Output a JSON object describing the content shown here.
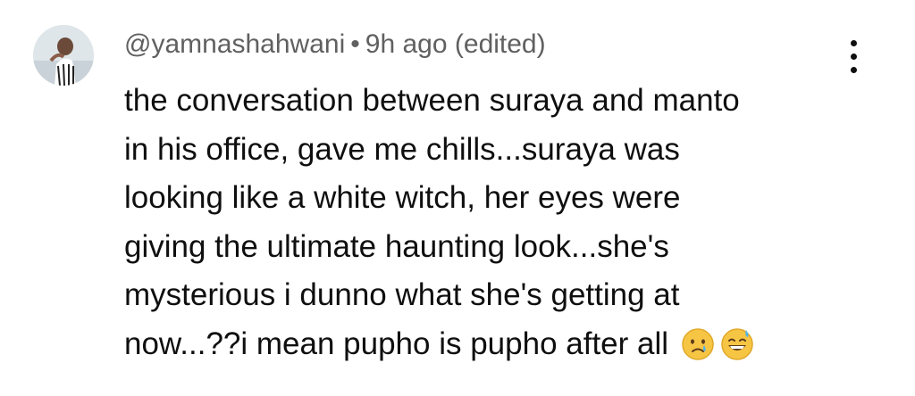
{
  "comment": {
    "author": "@yamnashahwani",
    "separator": "•",
    "time": "9h ago",
    "edited": "(edited)",
    "lines": [
      "the conversation between suraya and manto",
      "in his office, gave me chills...suraya was",
      "looking like a white witch, her eyes were",
      "giving the ultimate haunting look...she's",
      "mysterious i dunno what she's getting at",
      "now...??i mean pupho is pupho after all"
    ],
    "emojis": [
      "crying-face",
      "grinning-face-with-sweat"
    ]
  },
  "icons": {
    "avatar": "profile-photo",
    "menu": "more-vertical-icon"
  }
}
